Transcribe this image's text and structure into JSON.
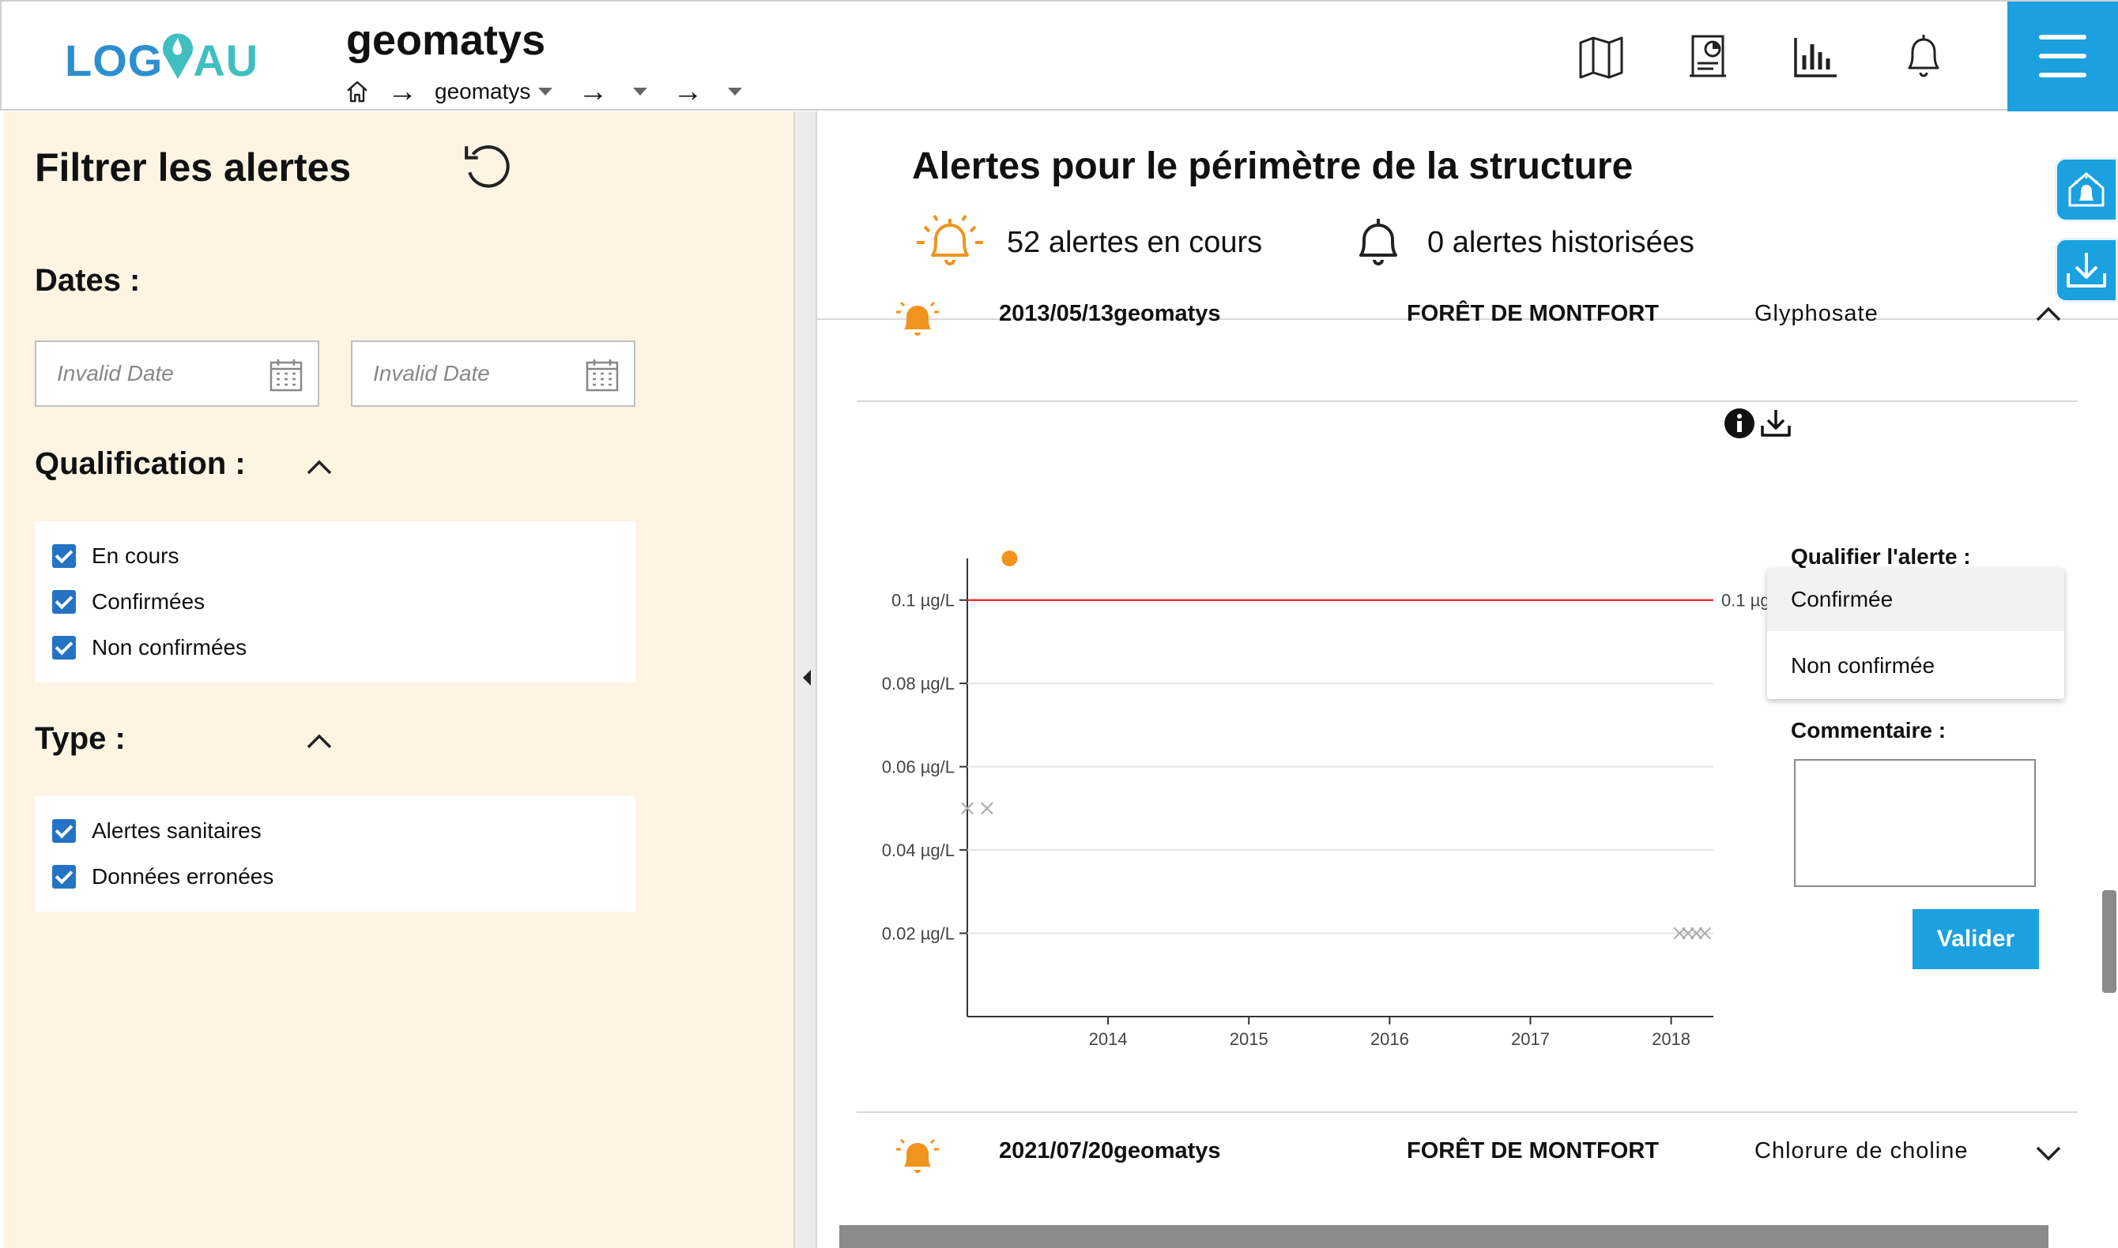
{
  "header": {
    "logo": {
      "part1": "LOG",
      "part2": "AU"
    },
    "org_name": "geomatys",
    "breadcrumb": {
      "level1": "geomatys"
    },
    "icons": [
      "map-icon",
      "report-icon",
      "chart-icon",
      "notification-bell-icon",
      "menu-icon"
    ]
  },
  "sidebar": {
    "title": "Filtrer les alertes",
    "dates": {
      "heading": "Dates :",
      "start_placeholder": "Invalid Date",
      "end_placeholder": "Invalid Date"
    },
    "qualification": {
      "heading": "Qualification :",
      "options": [
        {
          "label": "En cours",
          "checked": true
        },
        {
          "label": "Confirmées",
          "checked": true
        },
        {
          "label": "Non confirmées",
          "checked": true
        }
      ]
    },
    "type": {
      "heading": "Type :",
      "options": [
        {
          "label": "Alertes sanitaires",
          "checked": true
        },
        {
          "label": "Données erronées",
          "checked": true
        }
      ]
    }
  },
  "main": {
    "title": "Alertes pour le périmètre de la structure",
    "current_alerts": "52 alertes en cours",
    "archived_alerts": "0 alertes historisées",
    "alerts": [
      {
        "date": "2013/05/13geomatys",
        "site": "FORÊT DE MONTFORT",
        "substance": "Glyphosate",
        "expanded": true
      },
      {
        "date": "2021/07/20geomatys",
        "site": "FORÊT DE MONTFORT",
        "substance": "Chlorure de choline",
        "expanded": false
      }
    ],
    "qualify": {
      "title": "Qualifier l'alerte :",
      "options": [
        "Confirmée",
        "Non confirmée"
      ],
      "comment_label": "Commentaire :",
      "submit": "Valider"
    }
  },
  "colors": {
    "accent": "#1ba0e0",
    "alert_orange": "#f0941e",
    "threshold_red": "#e63333",
    "sidebar_bg": "#fef4e4",
    "checkbox_blue": "#2473c4"
  },
  "chart_data": {
    "type": "scatter",
    "x_ticks": [
      "2014",
      "2015",
      "2016",
      "2017",
      "2018"
    ],
    "y_ticks": [
      "0.02 µg/L",
      "0.04 µg/L",
      "0.06 µg/L",
      "0.08 µg/L",
      "0.1 µg/L"
    ],
    "ylim": [
      0,
      0.11
    ],
    "xlim": [
      2013.0,
      2018.3
    ],
    "threshold": {
      "value": 0.1,
      "label": "0.1 µg/L",
      "color": "#e63333"
    },
    "series": [
      {
        "marker": "circle",
        "color": "#f0941e",
        "points": [
          {
            "x": 2013.3,
            "y": 0.11
          }
        ]
      },
      {
        "marker": "cross",
        "color": "#aaaaaa",
        "points": [
          {
            "x": 2013.0,
            "y": 0.05
          },
          {
            "x": 2013.14,
            "y": 0.05
          },
          {
            "x": 2018.06,
            "y": 0.02
          },
          {
            "x": 2018.12,
            "y": 0.02
          },
          {
            "x": 2018.18,
            "y": 0.02
          },
          {
            "x": 2018.24,
            "y": 0.02
          }
        ]
      }
    ],
    "grid": true
  }
}
